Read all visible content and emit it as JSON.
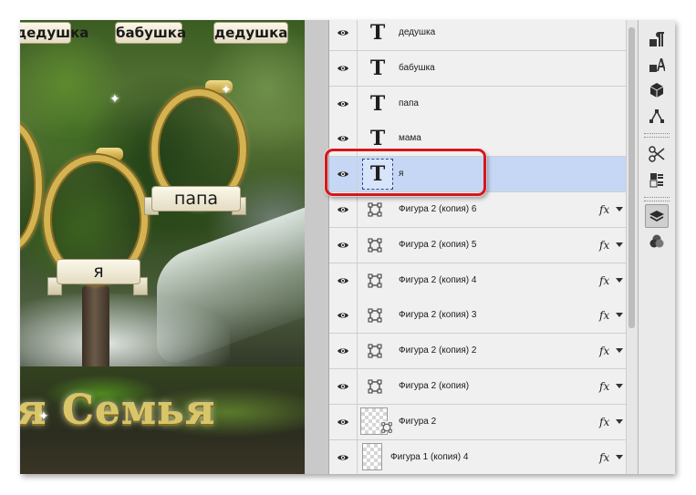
{
  "canvas": {
    "top_ribbons": [
      "дедушка",
      "бабушка",
      "дедушка"
    ],
    "frame_labels": [
      "папа",
      "я"
    ],
    "title": "я Семья"
  },
  "layers": {
    "items": [
      {
        "name": "дедушка",
        "kind": "text",
        "fx": ""
      },
      {
        "name": "бабушка",
        "kind": "text",
        "fx": ""
      },
      {
        "name": "папа",
        "kind": "text",
        "fx": ""
      },
      {
        "name": "мама",
        "kind": "text",
        "fx": ""
      },
      {
        "name": "я",
        "kind": "text",
        "selected": true,
        "fx": ""
      },
      {
        "name": "Фигура 2 (копия) 6",
        "kind": "shape",
        "fx": "fx"
      },
      {
        "name": "Фигура 2 (копия) 5",
        "kind": "shape",
        "fx": "fx"
      },
      {
        "name": "Фигура 2 (копия) 4",
        "kind": "shape",
        "fx": "fx"
      },
      {
        "name": "Фигура 2 (копия) 3",
        "kind": "shape",
        "fx": "fx"
      },
      {
        "name": "Фигура 2 (копия) 2",
        "kind": "shape",
        "fx": "fx"
      },
      {
        "name": "Фигура 2 (копия)",
        "kind": "shape",
        "fx": "fx"
      },
      {
        "name": "Фигура 2",
        "kind": "shape-image",
        "fx": "fx"
      },
      {
        "name": "Фигура 1 (копия) 4",
        "kind": "image",
        "fx": "fx"
      }
    ],
    "thumb_glyph": "T"
  },
  "toolbar": {
    "tools": [
      "paragraph-style-icon",
      "character-style-icon",
      "3d-icon",
      "paths-icon",
      "tool-presets-icon",
      "properties-icon",
      "layers-icon",
      "channels-icon"
    ]
  },
  "colors": {
    "highlight": "#d8151b",
    "selected_row": "#c6d7f5",
    "ribbon_gold": "#d4b452"
  }
}
